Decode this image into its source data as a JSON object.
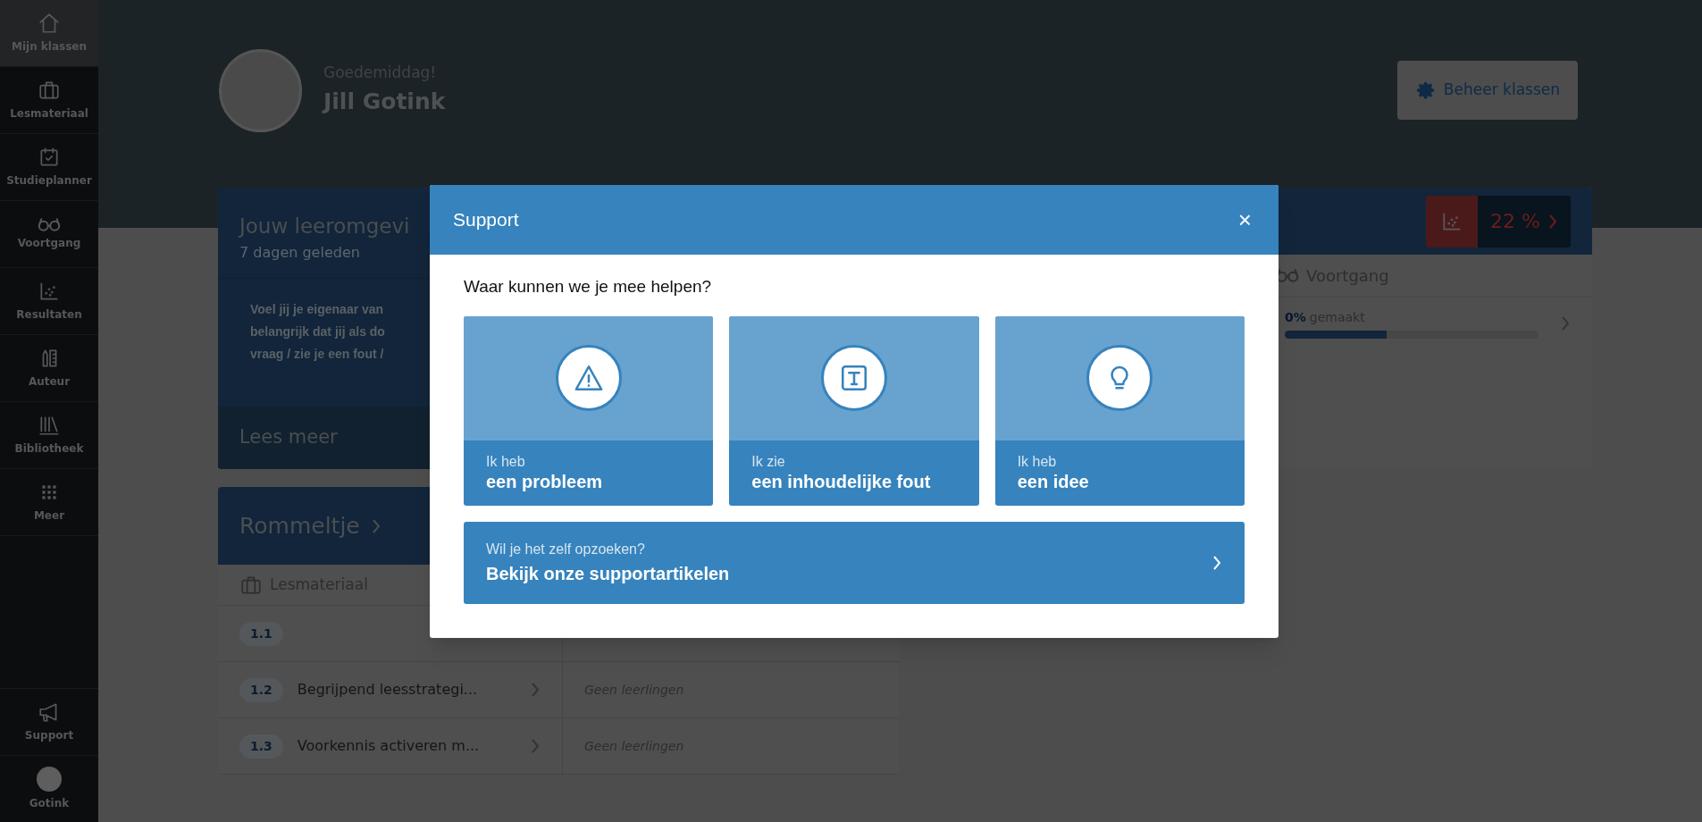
{
  "sidebar": {
    "items": [
      {
        "label": "Mijn klassen",
        "selected": true
      },
      {
        "label": "Lesmateriaal",
        "selected": false
      },
      {
        "label": "Studieplanner",
        "selected": false
      },
      {
        "label": "Voortgang",
        "selected": false
      },
      {
        "label": "Resultaten",
        "selected": false
      },
      {
        "label": "Auteur",
        "selected": false
      },
      {
        "label": "Bibliotheek",
        "selected": false
      },
      {
        "label": "Meer",
        "selected": false
      }
    ],
    "bottom_items": [
      {
        "label": "Support",
        "kind": "icon"
      },
      {
        "label": "Gotink",
        "kind": "avatar"
      }
    ]
  },
  "header": {
    "greeting": "Goedemiddag!",
    "name": "Jill Gotink",
    "manage_button": "Beheer klassen"
  },
  "news_card": {
    "title": "Jouw leeromgevi",
    "date": "7 dagen geleden",
    "lines": [
      "Voel jij je eigenaar van",
      "belangrijk dat jij als do",
      "vraag / zie je een fout /"
    ],
    "link": "Lees meer"
  },
  "class_card": {
    "score": "22 %",
    "section": "Voortgang",
    "progress": {
      "percent": "0%",
      "label": "gemaakt",
      "level": 0.4
    }
  },
  "group_card": {
    "title": "Rommeltje",
    "section": "Lesmateriaal",
    "rows": [
      {
        "number": "1.1"
      },
      {
        "number": "1.2",
        "title": "Begrijpend leesstrategi...",
        "status": "Geen leerlingen"
      },
      {
        "number": "1.3",
        "title": "Voorkennis activeren m...",
        "status": "Geen leerlingen"
      }
    ]
  },
  "modal": {
    "title": "Support",
    "close": "×",
    "question": "Waar kunnen we je mee helpen?",
    "options": [
      {
        "line1": "Ik heb",
        "line2": "een probleem"
      },
      {
        "line1": "Ik zie",
        "line2": "een inhoudelijke fout"
      },
      {
        "line1": "Ik heb",
        "line2": "een idee"
      }
    ],
    "articles": {
      "line1": "Wil je het zelf opzoeken?",
      "line2": "Bekijk onze supportartikelen"
    }
  }
}
